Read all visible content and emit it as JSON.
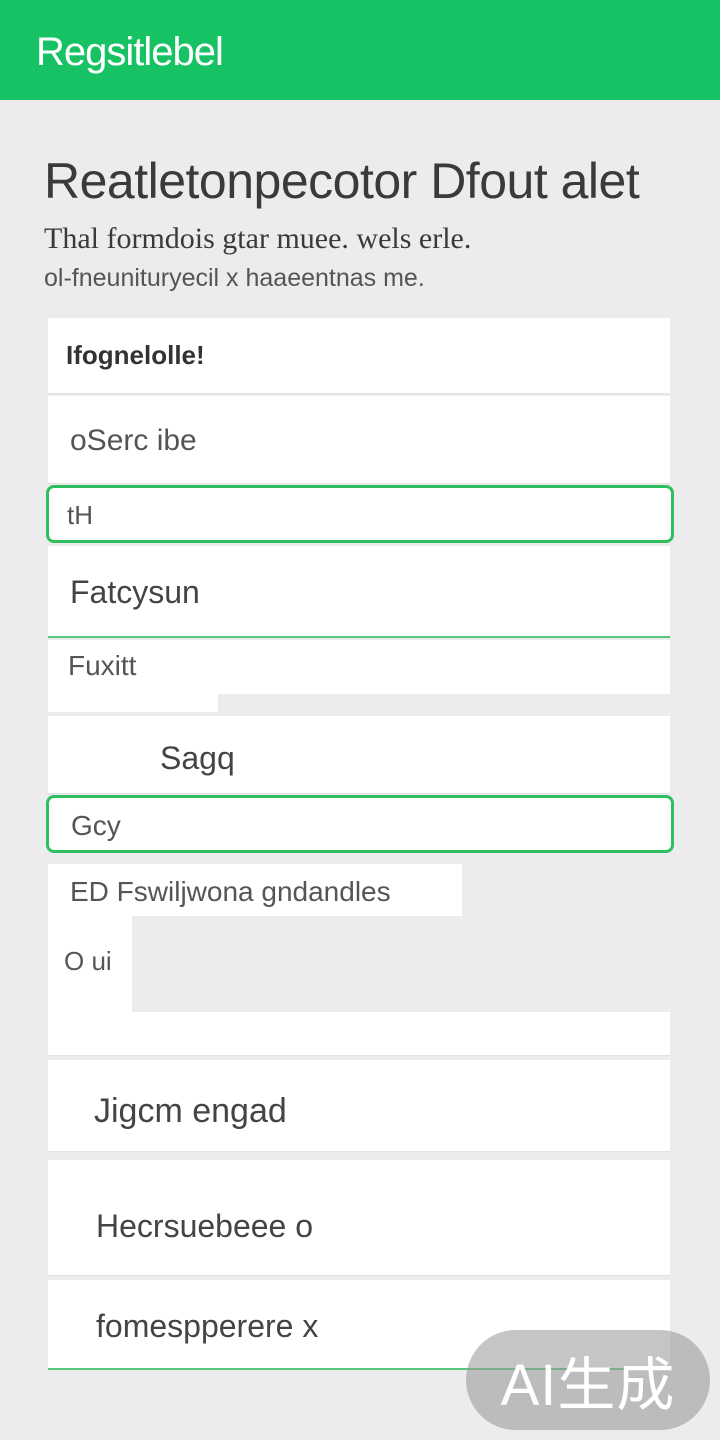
{
  "appbar": {
    "title": "Regsitlebel"
  },
  "header": {
    "title": "Reatletonpecotor Dfout alet",
    "subtitle_line1": "Thal formdois gtar muee. wels erle.",
    "subtitle_line2": "ol-fneunituryecil x haaeentnas me."
  },
  "form": {
    "section_heading": "Ifognelolle!",
    "fields": [
      {
        "label": "oSerc ibe"
      },
      {
        "label": "tH",
        "state": "focused"
      },
      {
        "label": "Fatcysun"
      },
      {
        "label": "Fuxitt"
      },
      {
        "label": "Sagq"
      },
      {
        "label": "Gcy",
        "state": "focused"
      },
      {
        "label": "ED Fswiljwona gndandles"
      },
      {
        "label": "O ui"
      },
      {
        "label": "Jigcm engad"
      },
      {
        "label": "Hecrsuebeee o"
      },
      {
        "label": "fomespperere x"
      }
    ]
  },
  "badge": {
    "text": "AI生成"
  },
  "colors": {
    "accent": "#17c264",
    "focus_border": "#2fbf5f",
    "background": "#ececec"
  }
}
